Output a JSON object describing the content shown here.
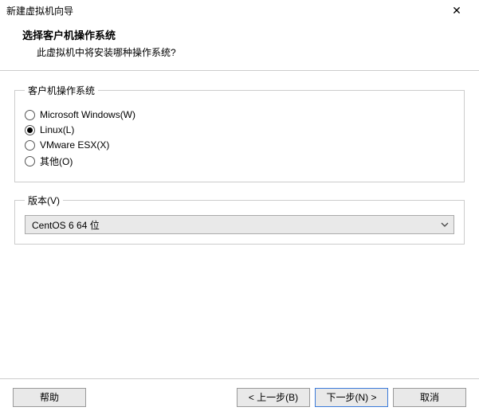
{
  "window": {
    "title": "新建虚拟机向导"
  },
  "header": {
    "heading": "选择客户机操作系统",
    "subheading": "此虚拟机中将安装哪种操作系统?"
  },
  "os_group": {
    "legend": "客户机操作系统",
    "options": [
      {
        "label": "Microsoft Windows(W)",
        "selected": false
      },
      {
        "label": "Linux(L)",
        "selected": true
      },
      {
        "label": "VMware ESX(X)",
        "selected": false
      },
      {
        "label": "其他(O)",
        "selected": false
      }
    ]
  },
  "version_group": {
    "legend": "版本(V)",
    "selected": "CentOS 6 64 位"
  },
  "buttons": {
    "help": "帮助",
    "back": "< 上一步(B)",
    "next": "下一步(N) >",
    "cancel": "取消"
  }
}
